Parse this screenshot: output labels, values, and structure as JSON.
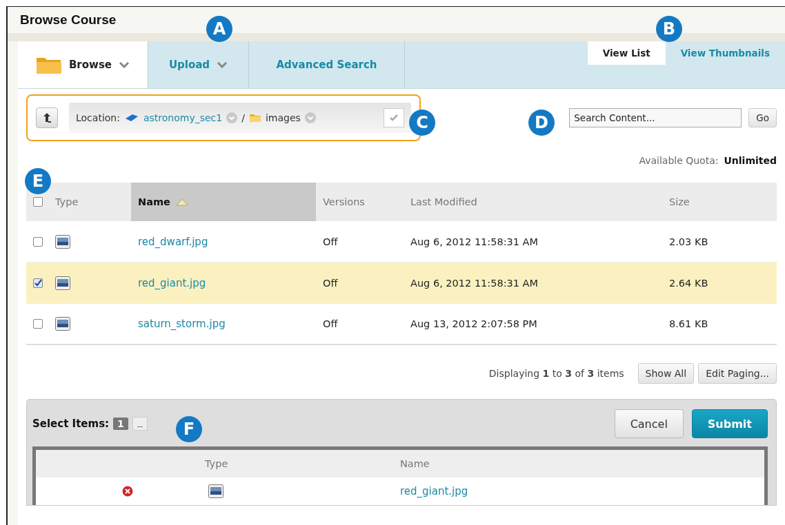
{
  "title": "Browse Course",
  "tabs": [
    {
      "label": "Browse",
      "selected": true,
      "kind": "folder"
    },
    {
      "label": "Upload",
      "selected": false,
      "kind": "menu"
    },
    {
      "label": "Advanced Search",
      "selected": false,
      "kind": "plain"
    }
  ],
  "views": [
    {
      "label": "View List",
      "selected": true
    },
    {
      "label": "View Thumbnails",
      "selected": false
    }
  ],
  "location": {
    "label": "Location:",
    "course": "astronomy_sec1",
    "separator": "/",
    "folder": "images"
  },
  "search": {
    "placeholder": "Search Content...",
    "button": "Go"
  },
  "quota": {
    "label": "Available Quota:",
    "value": "Unlimited"
  },
  "table": {
    "select_all_checked": false,
    "columns": [
      {
        "label": "Type",
        "sorted": false
      },
      {
        "label": "Name",
        "sorted": true
      },
      {
        "label": "Versions",
        "sorted": false
      },
      {
        "label": "Last Modified",
        "sorted": false
      },
      {
        "label": "Size",
        "sorted": false
      }
    ],
    "rows": [
      {
        "name": "red_dwarf.jpg",
        "versions": "Off",
        "modified": "Aug 6, 2012 11:58:31 AM",
        "size": "2.03 KB",
        "checked": false
      },
      {
        "name": "red_giant.jpg",
        "versions": "Off",
        "modified": "Aug 6, 2012 11:58:31 AM",
        "size": "2.64 KB",
        "checked": true
      },
      {
        "name": "saturn_storm.jpg",
        "versions": "Off",
        "modified": "Aug 13, 2012 2:07:58 PM",
        "size": "8.61 KB",
        "checked": false
      }
    ]
  },
  "paging": {
    "status": "Displaying **1** to **3** of **3** items",
    "buttons": [
      "Show All",
      "Edit Paging..."
    ]
  },
  "selection": {
    "label": "Select Items:",
    "count": "1",
    "cancel": "Cancel",
    "submit": "Submit",
    "columns": [
      "Type",
      "Name"
    ],
    "rows": [
      {
        "name": "red_giant.jpg"
      }
    ]
  },
  "callouts": [
    "A",
    "B",
    "C",
    "D",
    "E",
    "F"
  ]
}
